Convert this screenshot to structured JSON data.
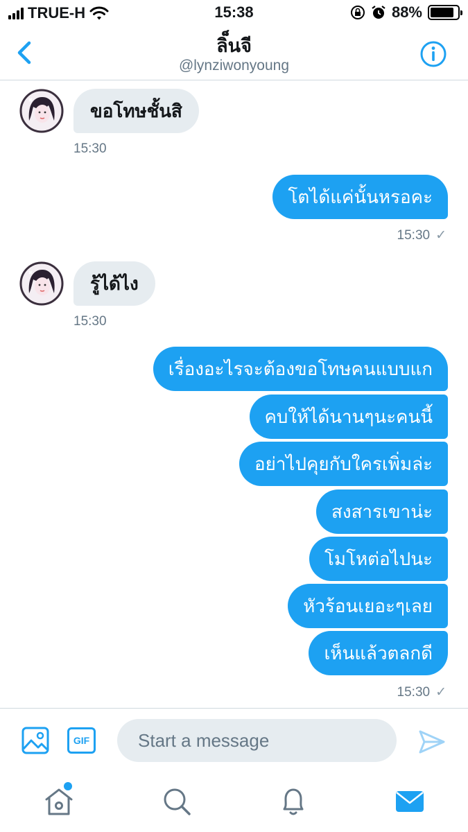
{
  "status_bar": {
    "carrier": "TRUE-H",
    "time": "15:38",
    "battery": "88%",
    "battery_level": 0.88,
    "icons": [
      "signal-icon",
      "wifi-icon",
      "orientation-lock-icon",
      "alarm-icon",
      "battery-icon"
    ]
  },
  "header": {
    "title": "ลิ็นจี",
    "handle": "@lynziwonyoung",
    "icons": [
      "back-chevron-icon",
      "info-icon"
    ]
  },
  "messages": [
    {
      "text": "ขอโทษชั้นสิ",
      "time": "15:30"
    },
    {
      "text": "โตได้แค่นั้นหรอคะ",
      "time": "15:30"
    },
    {
      "text": "รู้ได้ไง",
      "time": "15:30"
    },
    {
      "text": "เรื่องอะไรจะต้องขอโทษคนแบบแก"
    },
    {
      "text": "คบให้ได้นานๆนะคนนี้"
    },
    {
      "text": "อย่าไปคุยกับใครเพิ่มล่ะ"
    },
    {
      "text": "สงสารเขาน่ะ"
    },
    {
      "text": "โมโหต่อไปนะ"
    },
    {
      "text": "หัวร้อนเยอะๆเลย"
    },
    {
      "text": "เห็นแล้วตลกดี",
      "time": "15:30"
    }
  ],
  "composer": {
    "placeholder": "Start a message",
    "gif_label": "GIF",
    "icons": [
      "image-icon",
      "gif-icon",
      "send-icon"
    ]
  },
  "tabbar": {
    "icons": [
      "home-icon",
      "search-icon",
      "notifications-icon",
      "messages-icon"
    ],
    "active": "messages-icon",
    "accent": "#1da1f2"
  },
  "colors": {
    "accent": "#1da1f2",
    "incoming_bubble": "#e6ecf0",
    "secondary_text": "#657786"
  }
}
